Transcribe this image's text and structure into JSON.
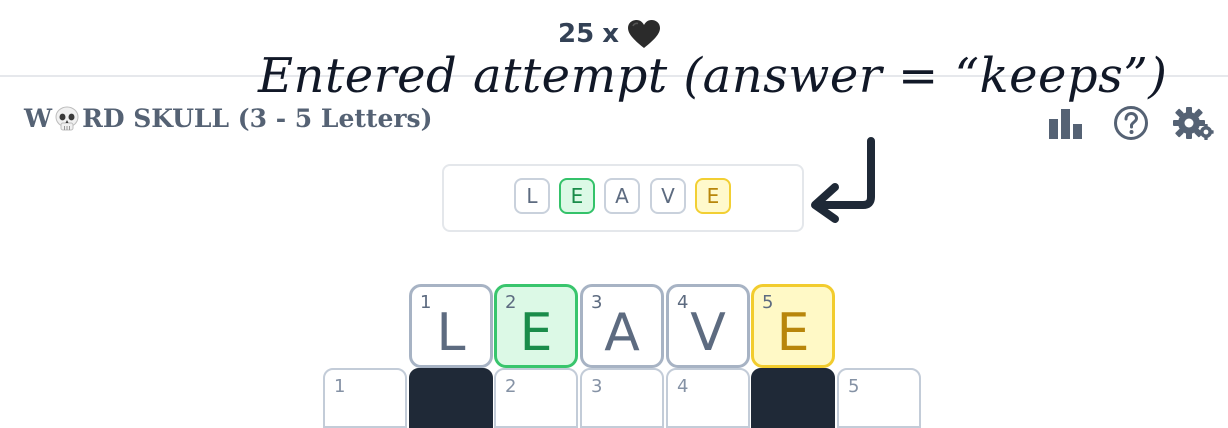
{
  "lives": {
    "count": "25",
    "separator": "x",
    "icon": "black-heart-icon"
  },
  "annotation": "Entered attempt (answer = “keeps”)",
  "header": {
    "title_prefix": "W",
    "title_suffix": "RD SKULL (3 - 5 Letters)",
    "title_icon": "skull-icon",
    "icons": [
      "stats-icon",
      "help-icon",
      "settings-icon"
    ]
  },
  "attempt": [
    {
      "letter": "L",
      "state": "absent"
    },
    {
      "letter": "E",
      "state": "correct"
    },
    {
      "letter": "A",
      "state": "absent"
    },
    {
      "letter": "V",
      "state": "absent"
    },
    {
      "letter": "E",
      "state": "present"
    }
  ],
  "board_row": [
    {
      "num": "1",
      "letter": "L",
      "state": "absent"
    },
    {
      "num": "2",
      "letter": "E",
      "state": "correct"
    },
    {
      "num": "3",
      "letter": "A",
      "state": "absent"
    },
    {
      "num": "4",
      "letter": "V",
      "state": "absent"
    },
    {
      "num": "5",
      "letter": "E",
      "state": "present"
    }
  ],
  "grid_row": [
    {
      "num": "1",
      "type": "open"
    },
    {
      "num": "",
      "type": "blocked"
    },
    {
      "num": "2",
      "type": "open"
    },
    {
      "num": "3",
      "type": "open"
    },
    {
      "num": "4",
      "type": "open"
    },
    {
      "num": "",
      "type": "blocked"
    },
    {
      "num": "5",
      "type": "open"
    }
  ],
  "colors": {
    "correct": "#34c26a",
    "present": "#f2cf33",
    "absent": "#a7b3c4",
    "blocked": "#1f2937"
  }
}
